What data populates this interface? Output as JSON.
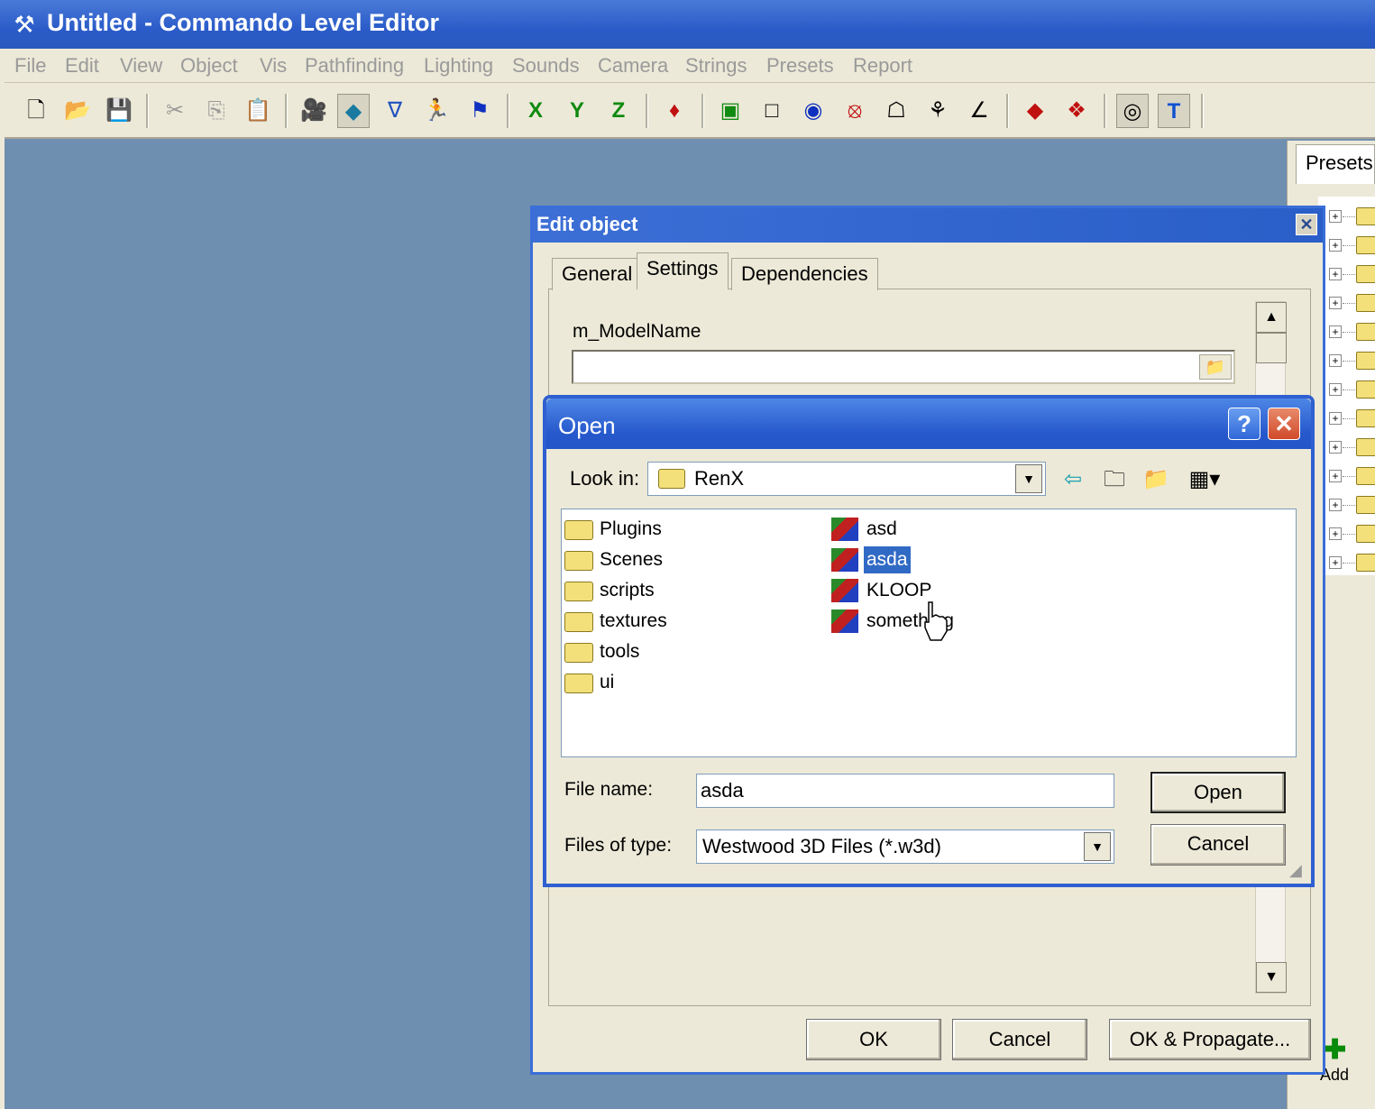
{
  "window": {
    "title": "Untitled - Commando Level Editor"
  },
  "menu": [
    "File",
    "Edit",
    "View",
    "Object",
    "Vis",
    "Pathfinding",
    "Lighting",
    "Sounds",
    "Camera",
    "Strings",
    "Presets",
    "Report"
  ],
  "toolbar": {
    "axis_x": "X",
    "axis_y": "Y",
    "axis_z": "Z",
    "text_tool": "T"
  },
  "presets_panel": {
    "tab_label": "Presets",
    "add_label": "Add"
  },
  "edit_dialog": {
    "title": "Edit object",
    "tabs": [
      "General",
      "Settings",
      "Dependencies"
    ],
    "active_tab": "Settings",
    "field_label": "m_ModelName",
    "field_value": "",
    "ok": "OK",
    "cancel": "Cancel",
    "ok_propagate": "OK & Propagate..."
  },
  "open_dialog": {
    "title": "Open",
    "look_in_label": "Look in:",
    "look_in_value": "RenX",
    "folders": [
      "Plugins",
      "Scenes",
      "scripts",
      "textures",
      "tools",
      "ui"
    ],
    "files": [
      "asd",
      "asda",
      "KLOOP",
      "something"
    ],
    "selected_file": "asda",
    "file_name_label": "File name:",
    "file_name_value": "asda",
    "file_type_label": "Files of type:",
    "file_type_value": "Westwood 3D Files (*.w3d)",
    "open_button": "Open",
    "cancel_button": "Cancel"
  }
}
